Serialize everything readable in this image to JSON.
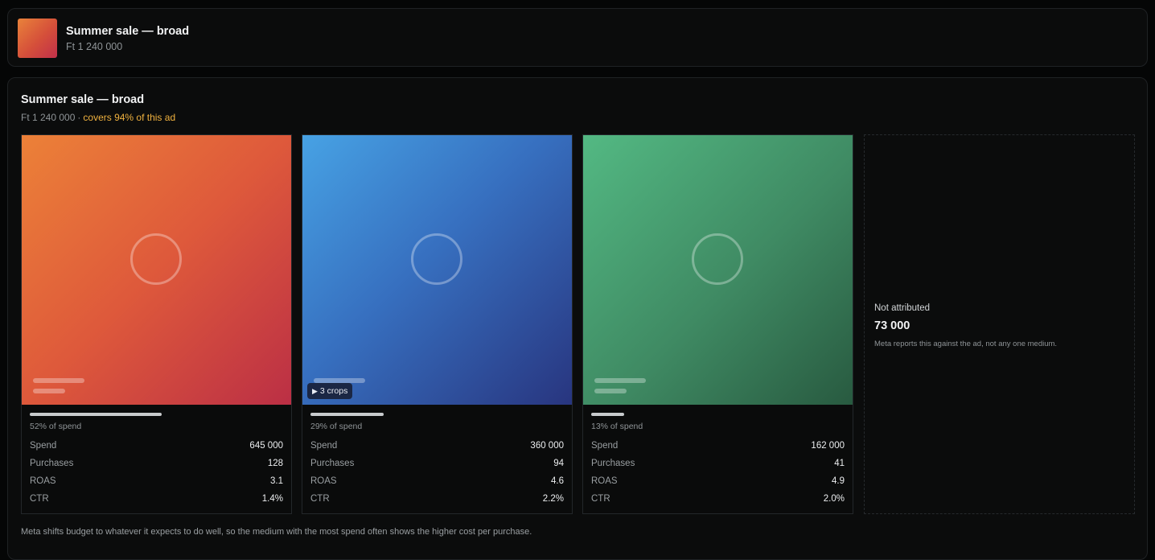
{
  "header": {
    "title": "Summer sale — broad",
    "amount": "Ft 1 240 000"
  },
  "main": {
    "title": "Summer sale — broad",
    "amount": "Ft 1 240 000",
    "separator": "·",
    "coverage": "covers 94% of this ad"
  },
  "media": [
    {
      "color": "orange",
      "spend_share": 0.52,
      "spend_pct_label": "52% of spend",
      "badge": null,
      "stats": [
        {
          "label": "Spend",
          "value": "645 000"
        },
        {
          "label": "Purchases",
          "value": "128"
        },
        {
          "label": "ROAS",
          "value": "3.1"
        },
        {
          "label": "CTR",
          "value": "1.4%"
        }
      ]
    },
    {
      "color": "blue",
      "spend_share": 0.29,
      "spend_pct_label": "29% of spend",
      "badge": "3 crops",
      "stats": [
        {
          "label": "Spend",
          "value": "360 000"
        },
        {
          "label": "Purchases",
          "value": "94"
        },
        {
          "label": "ROAS",
          "value": "4.6"
        },
        {
          "label": "CTR",
          "value": "2.2%"
        }
      ]
    },
    {
      "color": "green",
      "spend_share": 0.13,
      "spend_pct_label": "13% of spend",
      "badge": null,
      "stats": [
        {
          "label": "Spend",
          "value": "162 000"
        },
        {
          "label": "Purchases",
          "value": "41"
        },
        {
          "label": "ROAS",
          "value": "4.9"
        },
        {
          "label": "CTR",
          "value": "2.0%"
        }
      ]
    }
  ],
  "not_attributed": {
    "label": "Not attributed",
    "value": "73 000",
    "note": "Meta reports this against the ad, not any one medium."
  },
  "footnote": "Meta shifts budget to whatever it expects to do well, so the medium with the most spend often shows the higher cost per purchase.",
  "icons": {
    "play": "play-circle-icon",
    "crops": "play-triangle-icon"
  }
}
